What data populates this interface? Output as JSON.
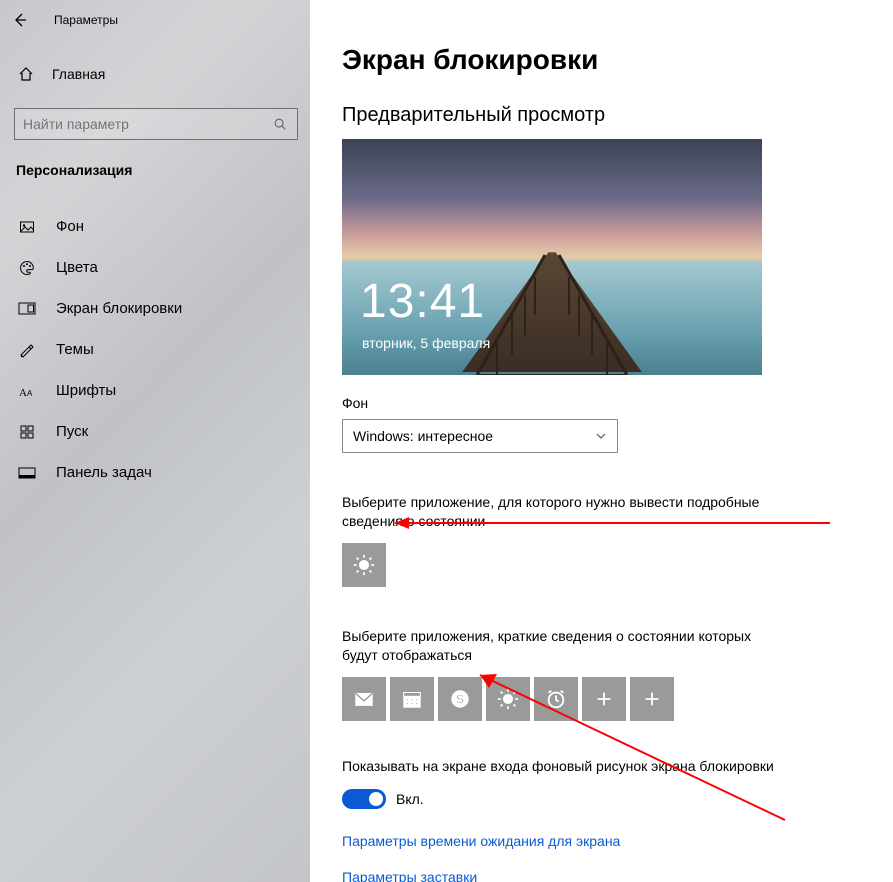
{
  "titlebar": {
    "title": "Параметры"
  },
  "sidebar": {
    "home": "Главная",
    "search_placeholder": "Найти параметр",
    "section": "Персонализация",
    "items": [
      {
        "label": "Фон",
        "icon": "picture"
      },
      {
        "label": "Цвета",
        "icon": "palette"
      },
      {
        "label": "Экран блокировки",
        "icon": "lockscreen"
      },
      {
        "label": "Темы",
        "icon": "themes"
      },
      {
        "label": "Шрифты",
        "icon": "fonts"
      },
      {
        "label": "Пуск",
        "icon": "start"
      },
      {
        "label": "Панель задач",
        "icon": "taskbar"
      }
    ]
  },
  "main": {
    "title": "Экран блокировки",
    "preview_label": "Предварительный просмотр",
    "preview_time": "13:41",
    "preview_date": "вторник, 5 февраля",
    "background_label": "Фон",
    "background_value": "Windows: интересное",
    "detailed_label": "Выберите приложение, для которого нужно вывести подробные сведения о состоянии",
    "detailed_apps": [
      "weather"
    ],
    "quick_label": "Выберите приложения, краткие сведения о состоянии которых будут отображаться",
    "quick_apps": [
      "mail",
      "calendar",
      "skype",
      "weather",
      "alarm",
      "plus",
      "plus"
    ],
    "signin_bg_label": "Показывать на экране входа фоновый рисунок экрана блокировки",
    "toggle_on": "Вкл.",
    "link_timeout": "Параметры времени ожидания для экрана",
    "link_screensaver": "Параметры заставки"
  }
}
